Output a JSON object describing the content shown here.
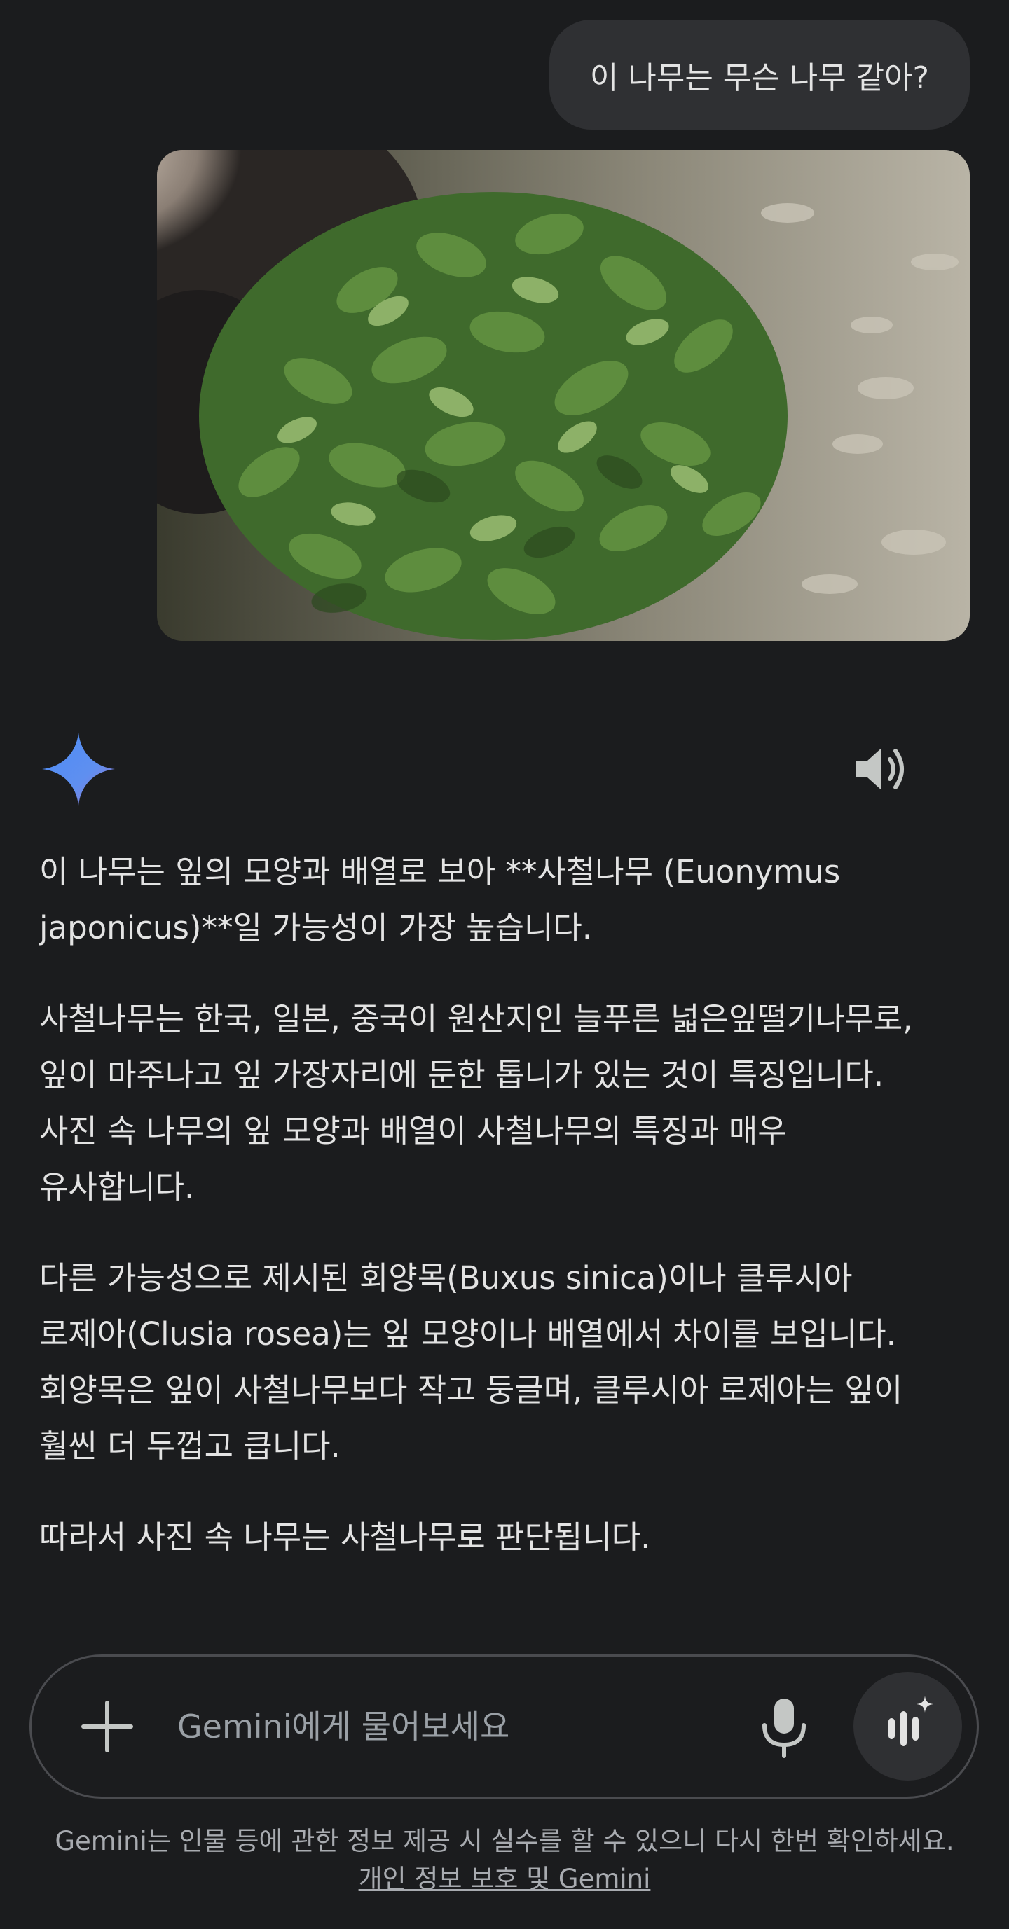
{
  "user_prompt": "이 나무는  무슨 나무 같아?",
  "response": {
    "paragraphs": [
      "이 나무는 잎의 모양과 배열로 보아 **사철나무 (Euonymus\njaponicus)**일 가능성이 가장 높습니다.",
      "사철나무는 한국, 일본, 중국이 원산지인 늘푸른 넓은잎떨기나무로,\n잎이 마주나고 잎 가장자리에 둔한 톱니가 있는 것이 특징입니다.\n사진 속 나무의 잎 모양과 배열이 사철나무의 특징과 매우\n유사합니다.",
      "다른 가능성으로 제시된 회양목(Buxus sinica)이나 클루시아\n로제아(Clusia rosea)는 잎 모양이나 배열에서 차이를 보입니다.\n회양목은 잎이 사철나무보다 작고 둥글며, 클루시아 로제아는 잎이\n훨씬 더 두껍고 큽니다.",
      "따라서 사진 속 나무는 사철나무로 판단됩니다."
    ]
  },
  "input": {
    "placeholder": "Gemini에게 물어보세요"
  },
  "footer": {
    "disclaimer": "Gemini는 인물 등에 관한 정보 제공 시 실수를 할 수 있으니 다시 한번 확인하세요.",
    "privacy_link": "개인 정보 보호 및 Gemini"
  },
  "icons": {
    "spark": "gemini-spark-icon",
    "speaker": "speaker-icon",
    "plus": "plus-icon",
    "mic": "microphone-icon",
    "live": "gemini-live-icon"
  },
  "colors": {
    "background": "#1b1c1e",
    "bubble": "#2f3033",
    "text": "#e3e3e3",
    "muted": "#9aa0a6",
    "spark_start": "#4c8df6",
    "spark_end": "#9b72cb"
  }
}
